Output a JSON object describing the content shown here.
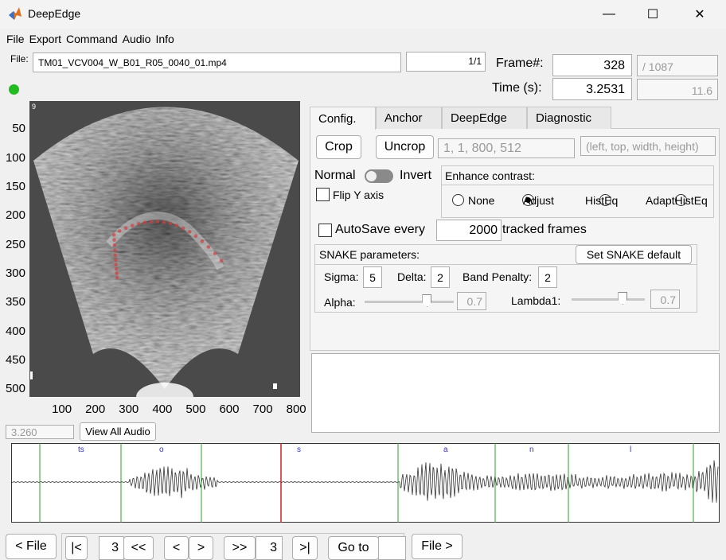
{
  "window": {
    "title": "DeepEdge",
    "minimize": "—",
    "maximize": "☐",
    "close": "✕"
  },
  "menu": [
    "File",
    "Export",
    "Command",
    "Audio",
    "Info"
  ],
  "file": {
    "label": "File:",
    "name": "TM01_VCV004_W_B01_R05_0040_01.mp4",
    "index": "1/1"
  },
  "frame": {
    "label": "Frame#:",
    "value": "328",
    "total": "/ 1087"
  },
  "time": {
    "label": "Time (s):",
    "value": "3.2531",
    "total": "11.6"
  },
  "status_color": "#22bb22",
  "image": {
    "y_ticks": [
      "50",
      "100",
      "150",
      "200",
      "250",
      "300",
      "350",
      "400",
      "450",
      "500"
    ],
    "x_ticks": [
      "100",
      "200",
      "300",
      "400",
      "500",
      "600",
      "700",
      "800"
    ],
    "corner_label": "9"
  },
  "tabs": [
    "Config.",
    "Anchor",
    "DeepEdge",
    "Diagnostic"
  ],
  "config": {
    "crop": "Crop",
    "uncrop": "Uncrop",
    "crop_value": "1, 1, 800, 512",
    "crop_hint": "(left, top, width, height)",
    "normal": "Normal",
    "invert": "Invert",
    "flip_y": "Flip Y axis",
    "enhance_title": "Enhance contrast:",
    "enhance_options": [
      "None",
      "Adjust",
      "HistEq",
      "AdaptHistEq"
    ],
    "enhance_selected": "Adjust",
    "autosave_label": "AutoSave every",
    "autosave_value": "2000",
    "autosave_suffix": "tracked frames",
    "snake_title": "SNAKE parameters:",
    "snake_default": "Set SNAKE default",
    "sigma_label": "Sigma:",
    "sigma": "5",
    "delta_label": "Delta:",
    "delta": "2",
    "band_label": "Band Penalty:",
    "band": "2",
    "alpha_label": "Alpha:",
    "alpha": "0.7",
    "lambda_label": "Lambda1:",
    "lambda": "0.7"
  },
  "audio": {
    "time": "3.260",
    "view_all": "View All Audio",
    "segments": [
      "ts",
      "o",
      "s",
      "a",
      "n",
      "l"
    ]
  },
  "nav": {
    "prev_file": "< File",
    "first": "|<",
    "step_back_value": "3",
    "fast_back": "<<",
    "prev": "<",
    "next": ">",
    "fast_fwd": ">>",
    "step_fwd_value": "3",
    "last": ">|",
    "goto": "Go to",
    "goto_value": "",
    "next_file": "File >"
  }
}
